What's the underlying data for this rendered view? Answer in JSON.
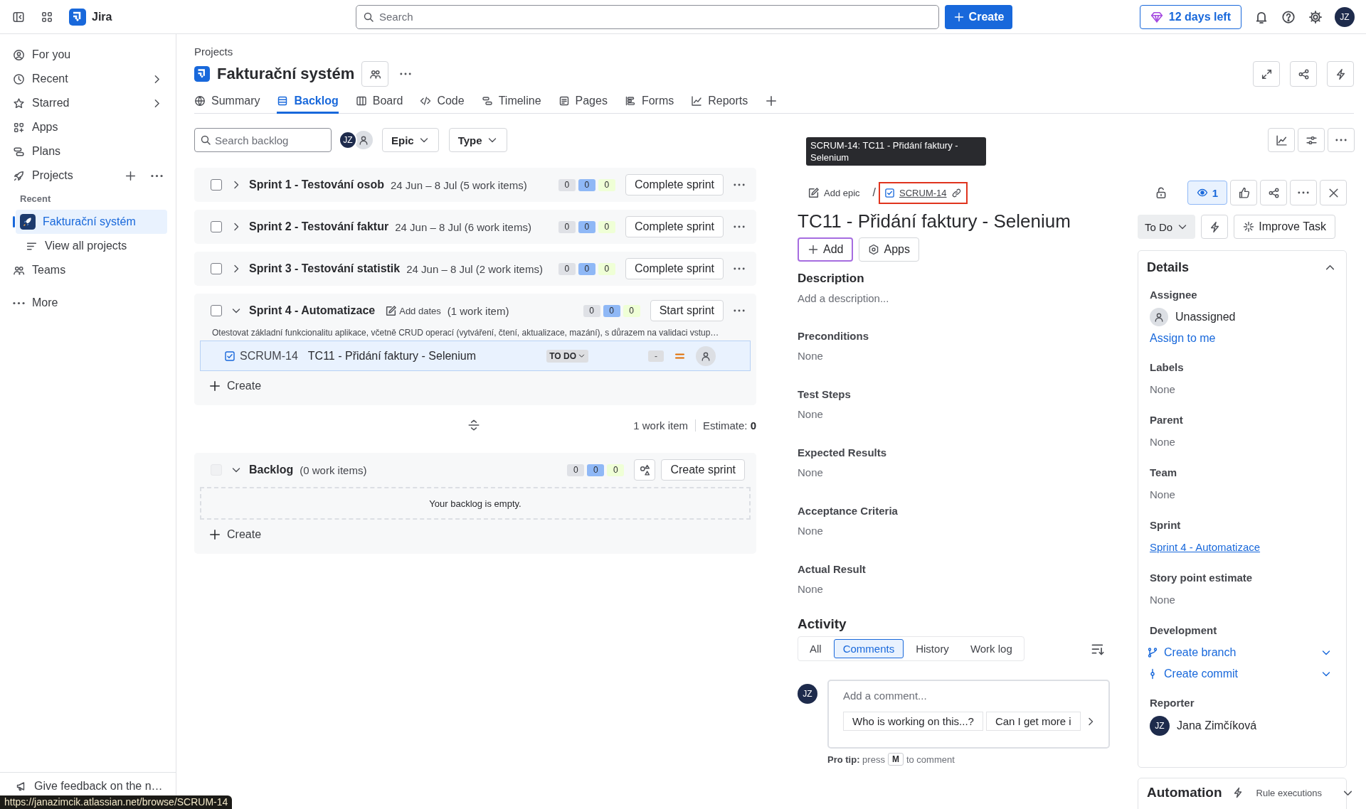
{
  "topbar": {
    "product": "Jira",
    "search_placeholder": "Search",
    "create": "Create",
    "trial": "12 days left",
    "avatar": "JZ"
  },
  "sidebar": {
    "items": [
      {
        "label": "For you",
        "kind": "link",
        "selected": false
      },
      {
        "label": "Recent",
        "kind": "menu",
        "selected": false
      },
      {
        "label": "Starred",
        "kind": "menu",
        "selected": false
      },
      {
        "label": "Apps",
        "kind": "link",
        "selected": false
      },
      {
        "label": "Plans",
        "kind": "link",
        "selected": false
      },
      {
        "label": "Projects",
        "kind": "section",
        "selected": false,
        "group_label": "Recent",
        "children": [
          {
            "label": "Fakturační systém",
            "kind": "project",
            "selected": true
          },
          {
            "label": "View all projects",
            "kind": "link",
            "selected": false
          }
        ]
      },
      {
        "label": "Teams",
        "kind": "link",
        "selected": false
      },
      {
        "label": "More",
        "kind": "link",
        "selected": false
      }
    ],
    "feedback": "Give feedback on the n…"
  },
  "header": {
    "breadcrumb": "Projects",
    "title": "Fakturační systém",
    "tabs": [
      {
        "label": "Summary",
        "selected": false
      },
      {
        "label": "Backlog",
        "selected": true
      },
      {
        "label": "Board",
        "selected": false
      },
      {
        "label": "Code",
        "selected": false
      },
      {
        "label": "Timeline",
        "selected": false
      },
      {
        "label": "Pages",
        "selected": false
      },
      {
        "label": "Forms",
        "selected": false
      },
      {
        "label": "Reports",
        "selected": false
      }
    ]
  },
  "backlog": {
    "search_placeholder": "Search backlog",
    "avatar": "JZ",
    "filters": [
      "Epic",
      "Type"
    ],
    "sprints": [
      {
        "name": "Sprint 1 - Testování osob",
        "dates": "24 Jun – 8 Jul (5 work items)",
        "checked": false,
        "expanded": false,
        "counts": [
          "0",
          "0",
          "0"
        ],
        "action": "Complete sprint"
      },
      {
        "name": "Sprint 2 - Testování faktur",
        "dates": "24 Jun – 8 Jul (6 work items)",
        "checked": false,
        "expanded": false,
        "counts": [
          "0",
          "0",
          "0"
        ],
        "action": "Complete sprint"
      },
      {
        "name": "Sprint 3 - Testování statistik",
        "dates": "24 Jun – 8 Jul (2 work items)",
        "checked": false,
        "expanded": false,
        "counts": [
          "0",
          "0",
          "0"
        ],
        "action": "Complete sprint"
      },
      {
        "name": "Sprint 4 - Automatizace",
        "add_dates": "Add dates",
        "dates": "(1 work item)",
        "checked": false,
        "expanded": true,
        "counts": [
          "0",
          "0",
          "0"
        ],
        "action": "Start sprint",
        "goal": "Otestovat základní funkcionalitu aplikace, včetně CRUD operací (vytváření, čtení, aktualizace, mazání), s důrazem na validaci vstup…",
        "items": [
          {
            "key": "SCRUM-14",
            "summary": "TC11 - Přidání faktury - Selenium",
            "status": "TO DO",
            "estimate": "-",
            "selected": true
          }
        ],
        "create": "Create"
      }
    ],
    "summary": {
      "count": "1 work item",
      "estimate": "Estimate: **0**"
    },
    "backlog": {
      "name": "Backlog",
      "dates": "(0 work items)",
      "disabled": true,
      "expanded": true,
      "counts": [
        "0",
        "0",
        "0"
      ],
      "action": "Create sprint",
      "empty": "Your backlog is empty.",
      "create": "Create"
    }
  },
  "detail": {
    "tooltip": "SCRUM-14: TC11 - Přidání faktury - Selenium",
    "breadcrumb": {
      "add_epic": "Add epic",
      "separator": "/",
      "key": {
        "text": "SCRUM-14",
        "highlighted": true
      }
    },
    "watchers": "1",
    "title": "TC11 - Přidání faktury - Selenium",
    "add": "Add",
    "apps": "Apps",
    "fields": [
      {
        "label": "Description",
        "value": "Add a description..."
      },
      {
        "label": "Preconditions",
        "value": "None"
      },
      {
        "label": "Test Steps",
        "value": "None"
      },
      {
        "label": "Expected Results",
        "value": "None"
      },
      {
        "label": "Acceptance Criteria",
        "value": "None"
      },
      {
        "label": "Actual Result",
        "value": "None"
      }
    ],
    "activity": {
      "title": "Activity",
      "tabs": [
        {
          "label": "All",
          "selected": false
        },
        {
          "label": "Comments",
          "selected": true
        },
        {
          "label": "History",
          "selected": false
        },
        {
          "label": "Work log",
          "selected": false
        }
      ],
      "avatar": "JZ",
      "placeholder": "Add a comment...",
      "suggestions": [
        "Who is working on this...?",
        "Can I get more i"
      ],
      "pro_tip": "**Pro tip:** press",
      "key": "M",
      "after": "to comment"
    },
    "status": "To Do",
    "improve": "Improve Task",
    "details": {
      "title": "Details",
      "expanded": true,
      "fields": [
        {
          "kind": "person",
          "label": "Assignee",
          "value": "Unassigned",
          "action": "Assign to me"
        },
        {
          "kind": "text",
          "label": "Labels",
          "value": "None"
        },
        {
          "kind": "text",
          "label": "Parent",
          "value": "None"
        },
        {
          "kind": "text",
          "label": "Team",
          "value": "None"
        },
        {
          "kind": "link",
          "label": "Sprint",
          "value": "Sprint 4 - Automatizace"
        },
        {
          "kind": "text",
          "label": "Story point estimate",
          "value": "None"
        },
        {
          "kind": "dev",
          "label": "Development",
          "items": [
            "Create branch",
            "Create commit"
          ]
        },
        {
          "kind": "person",
          "label": "Reporter",
          "value": "Jana Zimčíková",
          "avatar": "JZ"
        }
      ]
    },
    "automation": {
      "title": "Automation",
      "subtitle": "Rule executions",
      "expanded": false
    }
  },
  "status_url": "https://janazimcik.atlassian.net/browse/SCRUM-14"
}
